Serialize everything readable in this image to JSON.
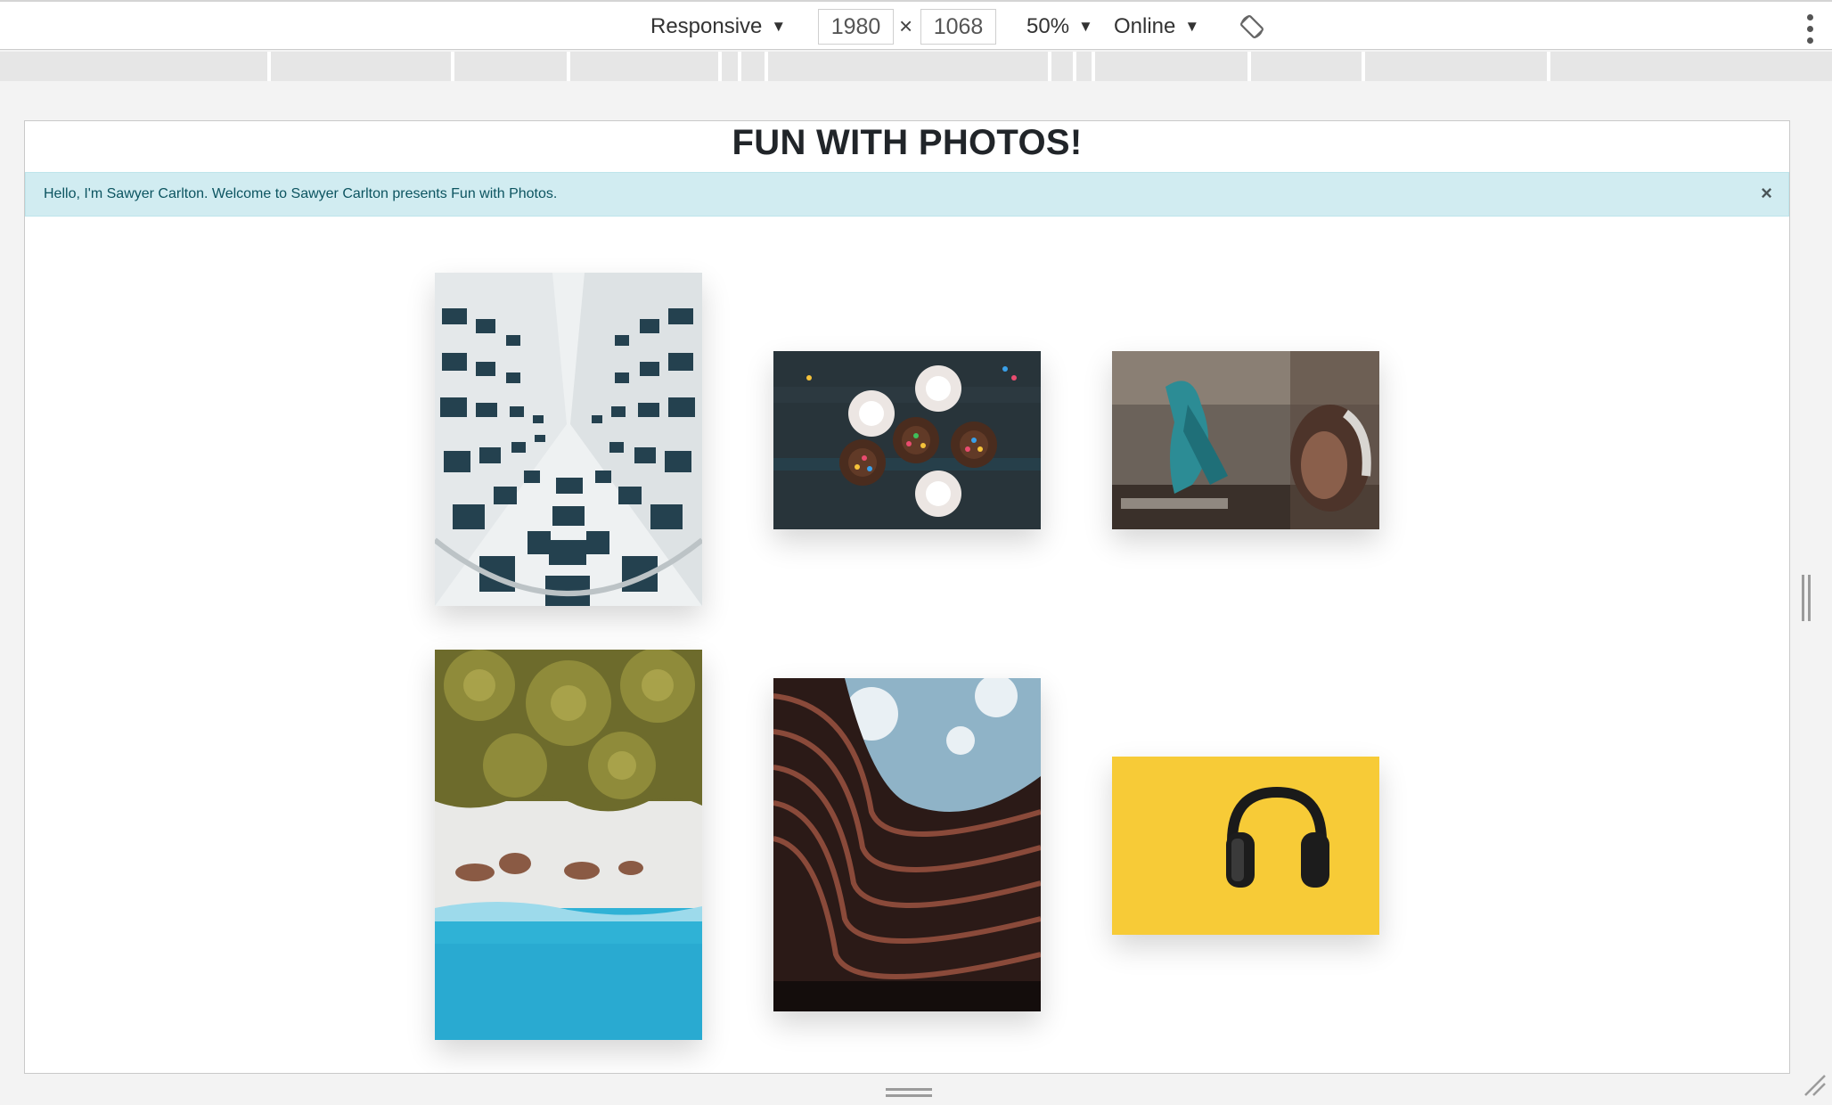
{
  "devtools": {
    "device": "Responsive",
    "width": "1980",
    "times": "×",
    "height": "1068",
    "zoom": "50%",
    "network": "Online",
    "icons": {
      "rotate": "rotate-icon",
      "more": "more-vert-icon"
    }
  },
  "page": {
    "title": "FUN WITH PHOTOS!",
    "alert": {
      "message": "Hello, I'm Sawyer Carlton. Welcome to Sawyer Carlton presents Fun with Photos.",
      "close": "×",
      "background": "#d1ecf1"
    },
    "photos": [
      {
        "name": "building-looking-up"
      },
      {
        "name": "cupcakes"
      },
      {
        "name": "graffiti-headphones-woman"
      },
      {
        "name": "palm-trees-beach"
      },
      {
        "name": "curved-building"
      },
      {
        "name": "headphones-yellow"
      }
    ]
  }
}
